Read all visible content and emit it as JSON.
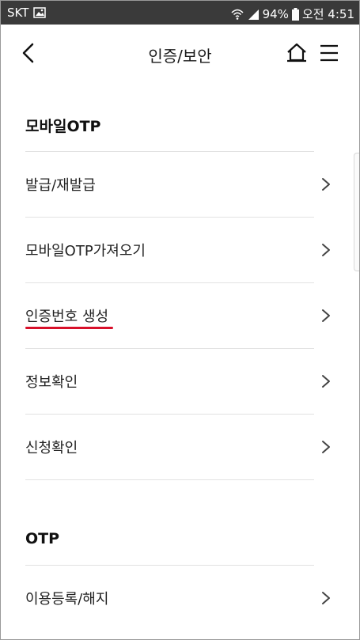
{
  "status_bar": {
    "carrier": "SKT",
    "battery": "94%",
    "time": "오전 4:51"
  },
  "header": {
    "title": "인증/보안",
    "back_icon": "chevron-left-icon",
    "home_icon": "home-icon",
    "menu_icon": "hamburger-menu-icon"
  },
  "sections": [
    {
      "title": "모바일OTP",
      "items": [
        {
          "label": "발급/재발급"
        },
        {
          "label": "모바일OTP가져오기"
        },
        {
          "label": "인증번호 생성",
          "highlighted": true
        },
        {
          "label": "정보확인"
        },
        {
          "label": "신청확인"
        }
      ]
    },
    {
      "title": "OTP",
      "items": [
        {
          "label": "이용등록/해지"
        }
      ]
    }
  ],
  "colors": {
    "status_bar_bg": "#3a3a3a",
    "highlight_underline": "#d8102a",
    "divider": "#e2e2e2"
  }
}
